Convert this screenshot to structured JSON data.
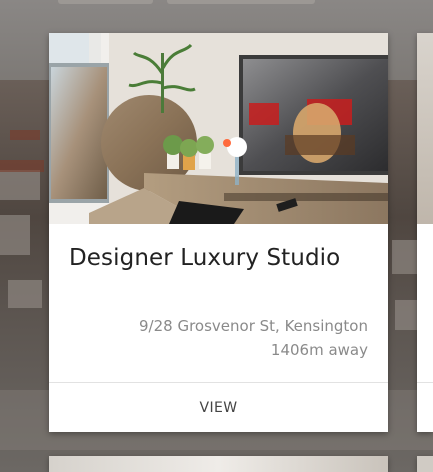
{
  "listing": {
    "title": "Designer Luxury Studio",
    "address": "9/28 Grosvenor St, Kensington",
    "distance": "1406m away",
    "action_label": "VIEW"
  },
  "colors": {
    "card_background": "#ffffff",
    "title_text": "#222222",
    "secondary_text": "#8a8a8a",
    "action_text": "#444444",
    "divider": "#e2e2e2"
  },
  "icons": [
    "listing-photo"
  ]
}
